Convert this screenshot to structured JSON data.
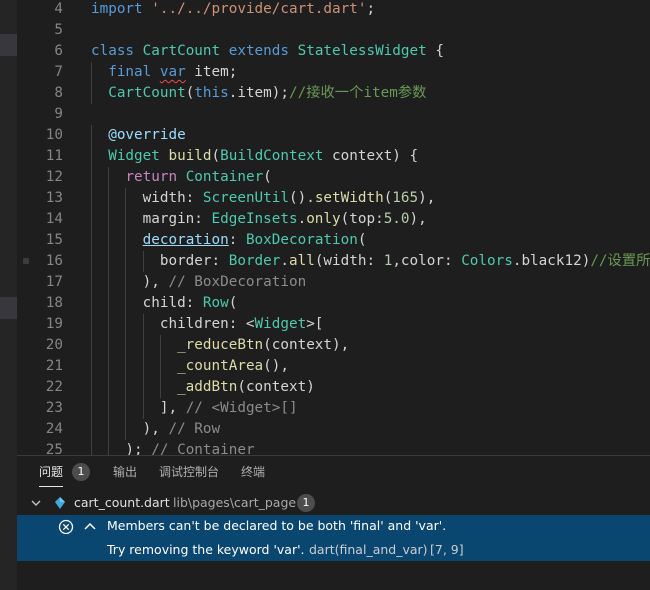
{
  "editor": {
    "lines": [
      {
        "num": "4",
        "tokens": [
          {
            "t": "import ",
            "c": "k"
          },
          {
            "t": "'../../provide/cart.dart'",
            "c": "s"
          },
          {
            "t": ";",
            "c": ""
          }
        ]
      },
      {
        "num": "5",
        "tokens": []
      },
      {
        "num": "6",
        "tokens": [
          {
            "t": "class ",
            "c": "k"
          },
          {
            "t": "CartCount ",
            "c": "t"
          },
          {
            "t": "extends ",
            "c": "k"
          },
          {
            "t": "StatelessWidget",
            "c": "t"
          },
          {
            "t": " {",
            "c": ""
          }
        ]
      },
      {
        "num": "7",
        "tokens": [
          {
            "t": "  ",
            "c": ""
          },
          {
            "t": "final ",
            "c": "k"
          },
          {
            "t": "var",
            "c": "k squig"
          },
          {
            "t": " item;",
            "c": ""
          }
        ]
      },
      {
        "num": "8",
        "tokens": [
          {
            "t": "  ",
            "c": ""
          },
          {
            "t": "CartCount",
            "c": "t"
          },
          {
            "t": "(",
            "c": ""
          },
          {
            "t": "this",
            "c": "k"
          },
          {
            "t": ".item);",
            "c": ""
          },
          {
            "t": "//接收一个item参数",
            "c": "cm"
          }
        ]
      },
      {
        "num": "9",
        "tokens": []
      },
      {
        "num": "10",
        "tokens": [
          {
            "t": "  ",
            "c": ""
          },
          {
            "t": "@override",
            "c": "v"
          }
        ]
      },
      {
        "num": "11",
        "tokens": [
          {
            "t": "  ",
            "c": ""
          },
          {
            "t": "Widget ",
            "c": "t"
          },
          {
            "t": "build",
            "c": "f"
          },
          {
            "t": "(",
            "c": ""
          },
          {
            "t": "BuildContext",
            "c": "t"
          },
          {
            "t": " context) {",
            "c": ""
          }
        ]
      },
      {
        "num": "12",
        "tokens": [
          {
            "t": "    ",
            "c": ""
          },
          {
            "t": "return ",
            "c": "c"
          },
          {
            "t": "Container",
            "c": "t"
          },
          {
            "t": "(",
            "c": ""
          }
        ]
      },
      {
        "num": "13",
        "tokens": [
          {
            "t": "      width: ",
            "c": ""
          },
          {
            "t": "ScreenUtil",
            "c": "t"
          },
          {
            "t": "().",
            "c": ""
          },
          {
            "t": "setWidth",
            "c": "f"
          },
          {
            "t": "(",
            "c": ""
          },
          {
            "t": "165",
            "c": "n"
          },
          {
            "t": "),",
            "c": ""
          }
        ]
      },
      {
        "num": "14",
        "tokens": [
          {
            "t": "      margin: ",
            "c": ""
          },
          {
            "t": "EdgeInsets",
            "c": "t"
          },
          {
            "t": ".",
            "c": ""
          },
          {
            "t": "only",
            "c": "f"
          },
          {
            "t": "(top:",
            "c": ""
          },
          {
            "t": "5.0",
            "c": "n"
          },
          {
            "t": "),",
            "c": ""
          }
        ]
      },
      {
        "num": "15",
        "tokens": [
          {
            "t": "      ",
            "c": ""
          },
          {
            "t": "decoration",
            "c": "v ul"
          },
          {
            "t": ": ",
            "c": ""
          },
          {
            "t": "BoxDecoration",
            "c": "t"
          },
          {
            "t": "(",
            "c": ""
          }
        ]
      },
      {
        "num": "16",
        "tokens": [
          {
            "t": "        border: ",
            "c": ""
          },
          {
            "t": "Border",
            "c": "t"
          },
          {
            "t": ".",
            "c": ""
          },
          {
            "t": "all",
            "c": "f"
          },
          {
            "t": "(width: ",
            "c": ""
          },
          {
            "t": "1",
            "c": "n"
          },
          {
            "t": ",color: ",
            "c": ""
          },
          {
            "t": "Colors",
            "c": "t"
          },
          {
            "t": ".black12)",
            "c": ""
          },
          {
            "t": "//设置所有",
            "c": "cm"
          }
        ]
      },
      {
        "num": "17",
        "tokens": [
          {
            "t": "      ), ",
            "c": ""
          },
          {
            "t": "// BoxDecoration",
            "c": "hint"
          }
        ]
      },
      {
        "num": "18",
        "tokens": [
          {
            "t": "      child: ",
            "c": ""
          },
          {
            "t": "Row",
            "c": "t"
          },
          {
            "t": "(",
            "c": ""
          }
        ]
      },
      {
        "num": "19",
        "tokens": [
          {
            "t": "        children: <",
            "c": ""
          },
          {
            "t": "Widget",
            "c": "t"
          },
          {
            "t": ">[",
            "c": ""
          }
        ]
      },
      {
        "num": "20",
        "tokens": [
          {
            "t": "          ",
            "c": ""
          },
          {
            "t": "_reduceBtn",
            "c": "f"
          },
          {
            "t": "(context),",
            "c": ""
          }
        ]
      },
      {
        "num": "21",
        "tokens": [
          {
            "t": "          ",
            "c": ""
          },
          {
            "t": "_countArea",
            "c": "f"
          },
          {
            "t": "(),",
            "c": ""
          }
        ]
      },
      {
        "num": "22",
        "tokens": [
          {
            "t": "          ",
            "c": ""
          },
          {
            "t": "_addBtn",
            "c": "f"
          },
          {
            "t": "(context)",
            "c": ""
          }
        ]
      },
      {
        "num": "23",
        "tokens": [
          {
            "t": "        ], ",
            "c": ""
          },
          {
            "t": "// <Widget>[]",
            "c": "hint"
          }
        ]
      },
      {
        "num": "24",
        "tokens": [
          {
            "t": "      ), ",
            "c": ""
          },
          {
            "t": "// Row",
            "c": "hint"
          }
        ]
      },
      {
        "num": "25",
        "tokens": [
          {
            "t": "    ); ",
            "c": ""
          },
          {
            "t": "// Container",
            "c": "hint"
          }
        ]
      }
    ]
  },
  "panel": {
    "tabs": [
      {
        "label": "问题",
        "active": true
      },
      {
        "label": "输出",
        "active": false
      },
      {
        "label": "调试控制台",
        "active": false
      },
      {
        "label": "终端",
        "active": false
      }
    ],
    "problems_count": "1",
    "file": {
      "name": "cart_count.dart",
      "path": "lib\\pages\\cart_page",
      "count": "1"
    },
    "problem": {
      "message": "Members can't be declared to be both 'final' and 'var'.",
      "hint": "Try removing the keyword 'var'.",
      "source": "dart(final_and_var)",
      "position": "[7, 9]"
    }
  },
  "colors": {
    "editor_bg": "#1e1e1e",
    "selection_bg": "#094771",
    "keyword": "#569cd6",
    "type": "#4ec9b0",
    "function": "#dcdcaa",
    "string": "#ce9178",
    "number": "#b5cea8",
    "comment": "#6a9955",
    "error": "#f14c4c"
  },
  "icons": {
    "error": "error-circle-icon",
    "expand": "chevron-up-icon",
    "collapse": "chevron-down-icon",
    "file": "dart-file-icon"
  }
}
